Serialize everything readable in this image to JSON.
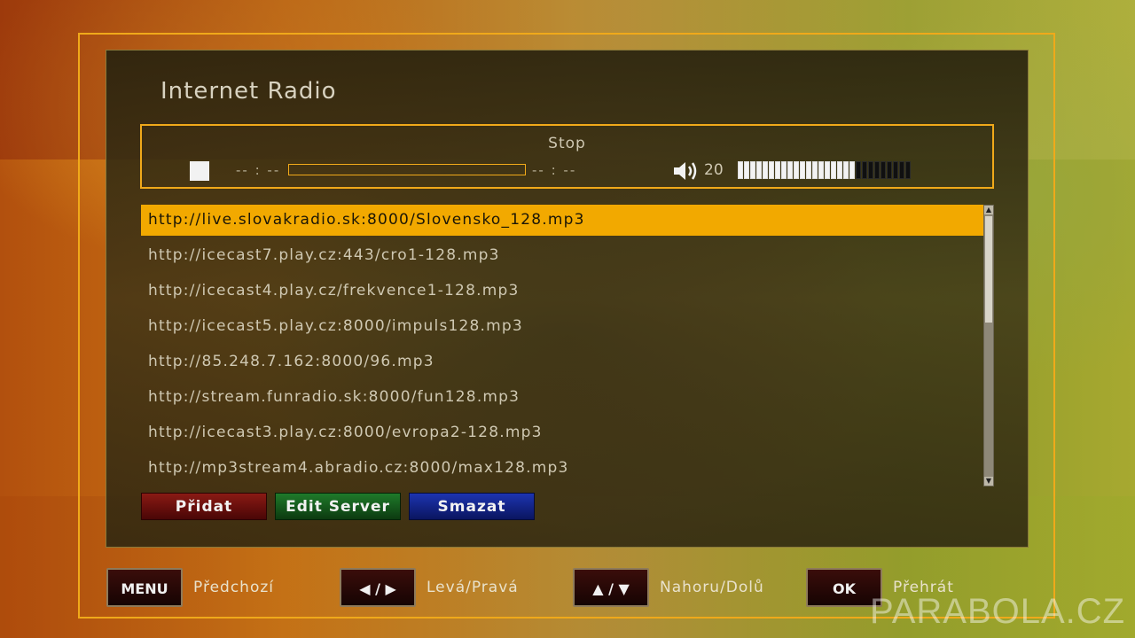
{
  "title": "Internet Radio",
  "player": {
    "status": "Stop",
    "time_elapsed": "-- : --",
    "time_total": "-- : --",
    "progress": 0,
    "volume": "20",
    "volume_segments_total": 28,
    "volume_segments_on": 19
  },
  "stations": [
    "http://live.slovakradio.sk:8000/Slovensko_128.mp3",
    "http://icecast7.play.cz:443/cro1-128.mp3",
    "http://icecast4.play.cz/frekvence1-128.mp3",
    "http://icecast5.play.cz:8000/impuls128.mp3",
    "http://85.248.7.162:8000/96.mp3",
    "http://stream.funradio.sk:8000/fun128.mp3",
    "http://icecast3.play.cz:8000/evropa2-128.mp3",
    "http://mp3stream4.abradio.cz:8000/max128.mp3"
  ],
  "selected_index": 0,
  "buttons": {
    "red": "Přidat",
    "green": "Edit Server",
    "blue": "Smazat"
  },
  "hints": [
    {
      "key": "MENU",
      "label": "Předchozí"
    },
    {
      "key": "◀ / ▶",
      "label": "Levá/Pravá"
    },
    {
      "key": "▲ / ▼",
      "label": "Nahoru/Dolů"
    },
    {
      "key": "OK",
      "label": "Přehrát"
    }
  ],
  "watermark": "PARABOLA.CZ",
  "colors": {
    "accent": "#f0a91a",
    "selected_row": "#f2a900",
    "red": "#8a1a14",
    "green": "#1f7a2a",
    "blue": "#1d34b0"
  }
}
